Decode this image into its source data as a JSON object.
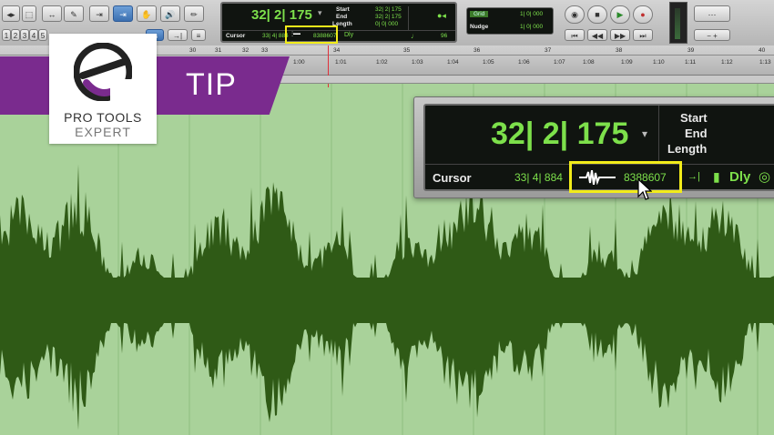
{
  "toolbar": {
    "nudge_buttons": [
      "2",
      "3",
      "4",
      "5"
    ],
    "main_counter": "32| 2| 175",
    "start_label": "Start",
    "end_label": "End",
    "length_label": "Length",
    "start_value": "32| 2| 175",
    "end_value": "32| 2| 175",
    "length_value": "0| 0| 000",
    "cursor_label": "Cursor",
    "cursor_value": "33| 4| 884",
    "sample_value": "8388607",
    "dly_label": "Dly",
    "tempo_value": "96",
    "grid_label": "Grid",
    "grid_value": "1| 0| 000",
    "nudge_label": "Nudge",
    "nudge_value": "1| 0| 000"
  },
  "ruler": {
    "bars": [
      "30",
      "31",
      "32",
      "33",
      "34",
      "35",
      "36",
      "37",
      "38",
      "39",
      "40"
    ],
    "times": [
      "1:00",
      "1:01",
      "1:02",
      "1:03",
      "1:04",
      "1:05",
      "1:06",
      "1:07",
      "1:08",
      "1:09",
      "1:10",
      "1:11",
      "1:12",
      "1:13"
    ]
  },
  "banner": {
    "tip_label": "TIP",
    "brand_line1": "PRO TOOLS",
    "brand_line2": "EXPERT"
  },
  "zoom": {
    "main_counter": "32| 2| 175",
    "start_label": "Start",
    "end_label": "End",
    "length_label": "Length",
    "cursor_label": "Cursor",
    "cursor_value": "33| 4| 884",
    "sample_value": "8388607",
    "dly_label": "Dly"
  },
  "colors": {
    "waveform": "#2f5a16",
    "clip_background": "#a9d29a",
    "counter_green": "#7de04b",
    "banner_purple": "#7a2b8e",
    "highlight": "#f2ec1a"
  }
}
